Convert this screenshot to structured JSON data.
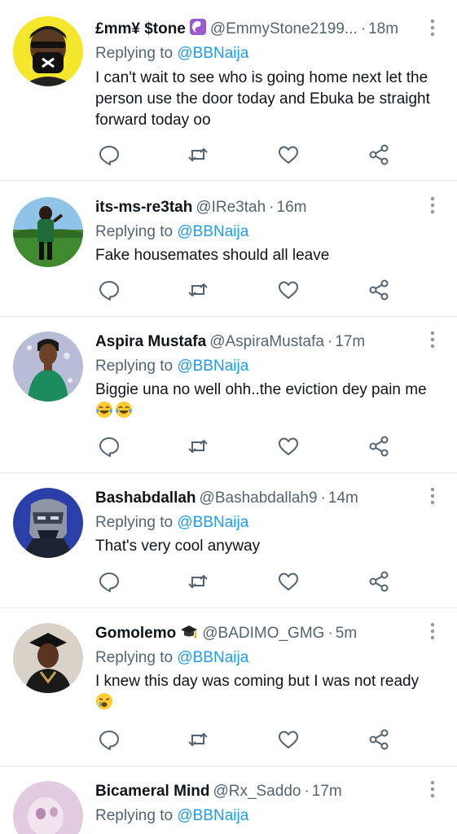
{
  "tweets": [
    {
      "name": "£mm¥ $tone",
      "badge": "yin-yang-emoji",
      "handle": "@EmmyStone2199...",
      "sep": "·",
      "time": "18m",
      "reply_prefix": "Replying to",
      "reply_to": "@BBNaija",
      "text": "I can't wait to see who is going home next let the person use the door today and Ebuka be straight forward today oo",
      "emojis": []
    },
    {
      "name": "its-ms-re3tah",
      "handle": "@IRe3tah",
      "sep": "·",
      "time": "16m",
      "reply_prefix": "Replying to",
      "reply_to": "@BBNaija",
      "text": "Fake housemates should all leave",
      "emojis": []
    },
    {
      "name": "Aspira Mustafa",
      "handle": "@AspiraMustafa",
      "sep": "·",
      "time": "17m",
      "reply_prefix": "Replying to",
      "reply_to": "@BBNaija",
      "text": "Biggie una no well ohh..the eviction dey pain me",
      "emojis": [
        "tears-of-joy-emoji",
        "tears-of-joy-emoji"
      ]
    },
    {
      "name": "Bashabdallah",
      "handle": "@Bashabdallah9",
      "sep": "·",
      "time": "14m",
      "reply_prefix": "Replying to",
      "reply_to": "@BBNaija",
      "text": "That's very cool anyway",
      "emojis": []
    },
    {
      "name": "Gomolemo",
      "badge": "graduation-cap-emoji",
      "handle": "@BADIMO_GMG",
      "sep": "·",
      "time": "5m",
      "reply_prefix": "Replying to",
      "reply_to": "@BBNaija",
      "text": "I knew this day was coming but I was not ready",
      "emojis": [
        "crying-face-emoji"
      ]
    },
    {
      "name": "Bicameral Mind",
      "handle": "@Rx_Saddo",
      "sep": "·",
      "time": "17m",
      "reply_prefix": "Replying to",
      "reply_to": "@BBNaija",
      "text": "",
      "emojis": []
    }
  ],
  "icons": {
    "reply": "reply-icon",
    "retweet": "retweet-icon",
    "like": "like-icon",
    "share": "share-icon",
    "more": "more-vertical-icon"
  },
  "colors": {
    "link": "#1d9bf0",
    "secondary": "#536471",
    "text": "#0f1419",
    "border": "#e6ecf0"
  }
}
